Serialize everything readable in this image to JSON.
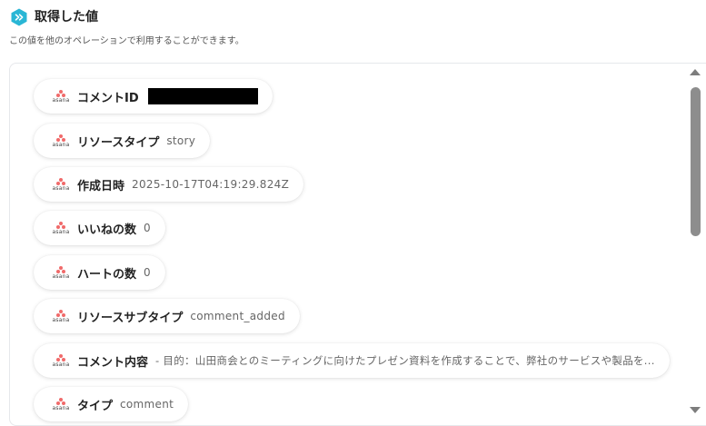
{
  "header": {
    "title": "取得した値",
    "subtitle": "この値を他のオペレーションで利用することができます。",
    "icon": "yoom-hex-icon",
    "accent": "#29b6d5"
  },
  "values": [
    {
      "label": "コメントID",
      "value": "",
      "redacted": true,
      "icon": "asana-logo-icon"
    },
    {
      "label": "リソースタイプ",
      "value": "story",
      "icon": "asana-logo-icon"
    },
    {
      "label": "作成日時",
      "value": "2025-10-17T04:19:29.824Z",
      "icon": "asana-logo-icon"
    },
    {
      "label": "いいねの数",
      "value": "0",
      "icon": "asana-logo-icon"
    },
    {
      "label": "ハートの数",
      "value": "0",
      "icon": "asana-logo-icon"
    },
    {
      "label": "リソースサブタイプ",
      "value": "comment_added",
      "icon": "asana-logo-icon"
    },
    {
      "label": "コメント内容",
      "value": "- 目的：山田商会とのミーティングに向けたプレゼン資料を作成することで、弊社のサービスや製品を...",
      "icon": "asana-logo-icon"
    },
    {
      "label": "タイプ",
      "value": "comment",
      "icon": "asana-logo-icon"
    }
  ],
  "brand": {
    "asana_word": "asana",
    "asana_color": "#f06a6a"
  }
}
